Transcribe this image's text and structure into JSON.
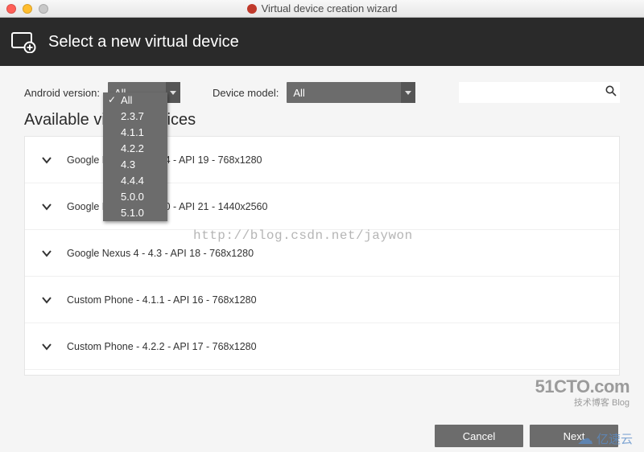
{
  "window": {
    "title": "Virtual device creation wizard"
  },
  "header": {
    "title": "Select a new virtual device"
  },
  "filters": {
    "version_label": "Android version:",
    "version_value": "All",
    "version_options": [
      "All",
      "2.3.7",
      "4.1.1",
      "4.2.2",
      "4.3",
      "4.4.4",
      "5.0.0",
      "5.1.0"
    ],
    "model_label": "Device model:",
    "model_value": "All",
    "search_placeholder": ""
  },
  "section_title": "Available virtual devices",
  "devices": [
    {
      "label": "Google Nexus 4 - 4.4.4 - API 19 - 768x1280"
    },
    {
      "label": "Google Nexus 6 - 5.0.0 - API 21 - 1440x2560"
    },
    {
      "label": "Google Nexus 4 - 4.3 - API 18 - 768x1280"
    },
    {
      "label": "Custom Phone - 4.1.1 - API 16 - 768x1280"
    },
    {
      "label": "Custom Phone - 4.2.2 - API 17 - 768x1280"
    }
  ],
  "buttons": {
    "cancel": "Cancel",
    "next": "Next"
  },
  "watermarks": {
    "url": "http://blog.csdn.net/jaywon",
    "cto_big": "51CTO.com",
    "cto_small": "技术博客  Blog",
    "yisu": "亿速云"
  }
}
